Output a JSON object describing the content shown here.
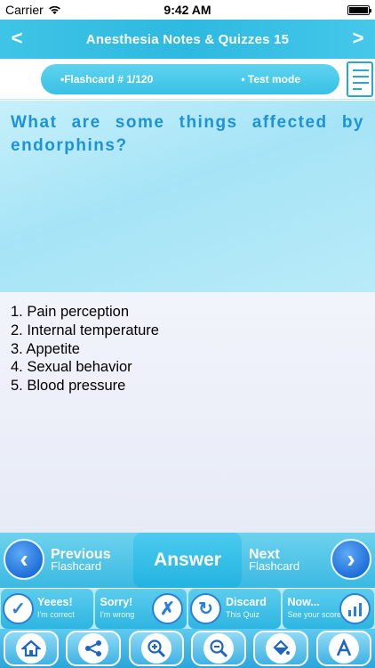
{
  "status_bar": {
    "carrier": "Carrier",
    "time": "9:42 AM"
  },
  "header": {
    "title": "Anesthesia Notes & Quizzes 15",
    "back_icon": "<",
    "forward_icon": ">"
  },
  "flashcard_bar": {
    "counter": "•Flashcard #  1/120",
    "mode": "• Test mode"
  },
  "question": "What are some things affected by endorphins?",
  "answer_lines": [
    "1. Pain perception",
    "2. Internal temperature",
    "3. Appetite",
    "4. Sexual behavior",
    "5. Blood pressure"
  ],
  "navigation": {
    "prev_label": "Previous",
    "prev_sub": "Flashcard",
    "answer_label": "Answer",
    "next_label": "Next",
    "next_sub": "Flashcard"
  },
  "actions": [
    {
      "label": "Yeees!",
      "sub": "I'm correct",
      "icon": "check-icon"
    },
    {
      "label": "Sorry!",
      "sub": "I'm wrong",
      "icon": "cross-icon"
    },
    {
      "label": "Discard",
      "sub": "This Quiz",
      "icon": "recycle-icon"
    },
    {
      "label": "Now...",
      "sub": "See your score",
      "icon": "chart-icon"
    }
  ],
  "tools": [
    "home-icon",
    "share-icon",
    "zoom-in-icon",
    "zoom-out-icon",
    "paint-bucket-icon",
    "font-icon"
  ],
  "colors": {
    "accent": "#3ec4e6",
    "question_text": "#1d93d6",
    "arrow_blue": "#1f6fd9"
  }
}
